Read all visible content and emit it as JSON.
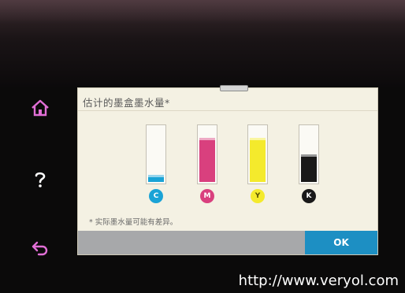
{
  "dialog": {
    "title": "估计的墨盒墨水量*",
    "note": "* 实际墨水量可能有差异。",
    "ok_label": "OK"
  },
  "cartridges": [
    {
      "id": "cyan",
      "label": "C",
      "color": "#1aa3d6",
      "level_pct": 13
    },
    {
      "id": "magenta",
      "label": "M",
      "color": "#d9407e",
      "level_pct": 80
    },
    {
      "id": "yellow",
      "label": "Y",
      "color": "#f4ea2c",
      "level_pct": 80
    },
    {
      "id": "black",
      "label": "K",
      "color": "#191919",
      "level_pct": 50
    }
  ],
  "side_keys": {
    "home_icon": "home-icon",
    "help_icon": "help-icon",
    "back_icon": "back-icon",
    "color": "#e26fd6"
  },
  "watermark": "http://www.veryol.com"
}
